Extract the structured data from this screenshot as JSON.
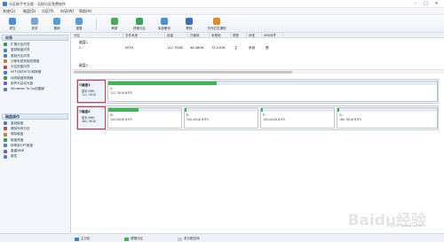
{
  "window": {
    "title": "分区助手专业版 - 无损分区免费软件",
    "minimize": "–",
    "maximize": "□",
    "close": "✕"
  },
  "menu": [
    "系统(G)",
    "磁盘(D)",
    "分区(P)",
    "向导(W)",
    "帮助(H)"
  ],
  "toolbar": [
    {
      "label": "提交",
      "icon": "check-icon",
      "color": "#4a8fd8"
    },
    {
      "label": "放弃",
      "icon": "discard-icon",
      "color": "#7aa3d6"
    },
    {
      "label": "撤销",
      "icon": "undo-icon",
      "color": "#5a9bd5"
    },
    {
      "label": "重做",
      "icon": "redo-icon",
      "color": "#5a9bd5"
    },
    {
      "label": "刷新",
      "icon": "refresh-icon",
      "color": "#4aa85a"
    },
    {
      "label": "快速分区",
      "icon": "quick-partition-icon",
      "color": "#3aa655"
    },
    {
      "label": "免费备份",
      "icon": "backup-icon",
      "color": "#4a8fd8"
    },
    {
      "label": "教程",
      "icon": "tutorial-icon",
      "color": "#3b6fb6"
    },
    {
      "label": "关闭日志通知",
      "icon": "log-icon",
      "color": "#e08a2e"
    }
  ],
  "sidebar": {
    "wizard_title": "向导",
    "wizard_items": [
      {
        "label": "扩展分区向导",
        "color": "#3a9a4a"
      },
      {
        "label": "复制磁盘向导",
        "color": "#4a7fc8"
      },
      {
        "label": "复制分区向导",
        "color": "#4a7fc8"
      },
      {
        "label": "迁移系统到固态硬盘",
        "color": "#d07a2a"
      },
      {
        "label": "分区恢复向导",
        "color": "#c44a4a"
      },
      {
        "label": "NTFS到FAT32转换器",
        "color": "#4a7fc8"
      },
      {
        "label": "动态磁盘转换器",
        "color": "#3a9a4a"
      },
      {
        "label": "制作可启动光盘",
        "color": "#7a5ac8"
      },
      {
        "label": "Windows To Go创建器",
        "color": "#4a7fc8"
      }
    ],
    "ops_title": "磁盘操作",
    "ops_items": [
      {
        "label": "复制磁盘",
        "color": "#4a7fc8"
      },
      {
        "label": "删除所有分区",
        "color": "#c44a4a"
      },
      {
        "label": "擦除磁盘",
        "color": "#d07a2a"
      },
      {
        "label": "磁盘测速",
        "color": "#3a9a4a"
      },
      {
        "label": "转换到GPT磁盘",
        "color": "#4a7fc8"
      },
      {
        "label": "重建MBR",
        "color": "#7a5ac8"
      },
      {
        "label": "属性",
        "color": "#4a7fc8"
      }
    ]
  },
  "table": {
    "headers": [
      "分区",
      "文件系统",
      "容量",
      "已使用",
      "未使用",
      "类型",
      "状态",
      "4KB对齐"
    ],
    "disk1_label": "磁盘1",
    "row1": [
      "C:",
      "NTFS",
      "111.79GB",
      "36.58GB",
      "75.21GB",
      "主",
      "系统",
      "是"
    ],
    "disk2_label": "磁盘2"
  },
  "disks": [
    {
      "name": "磁盘1",
      "type": "基本 MBR",
      "size": "111.79GB",
      "partitions": [
        {
          "letter": "C:",
          "desc": "111.79GB NTFS",
          "used_fraction": 0.33
        }
      ]
    },
    {
      "name": "磁盘2",
      "type": "基本 MBR",
      "size": "465.76GB",
      "partitions": [
        {
          "letter": "D:",
          "desc": "100.00GB NTFS",
          "used_fraction": 0.42
        },
        {
          "letter": "E:",
          "desc": "100.00GB NTFS",
          "used_fraction": 0.02
        },
        {
          "letter": "F:",
          "desc": "100.00GB NTFS",
          "used_fraction": 0.02
        },
        {
          "letter": "G:",
          "desc": "165.76GB NTFS",
          "used_fraction": 0.02
        }
      ]
    }
  ],
  "status": {
    "legend": [
      {
        "label": "主分区",
        "color": "#3a7fd0"
      },
      {
        "label": "逻辑分区",
        "color": "#3fb54f"
      },
      {
        "label": "未分配空间",
        "color": "#c9c9c9"
      }
    ]
  },
  "watermark": {
    "main": "Baidu经验",
    "sub": "jingyan.baidu.com"
  }
}
